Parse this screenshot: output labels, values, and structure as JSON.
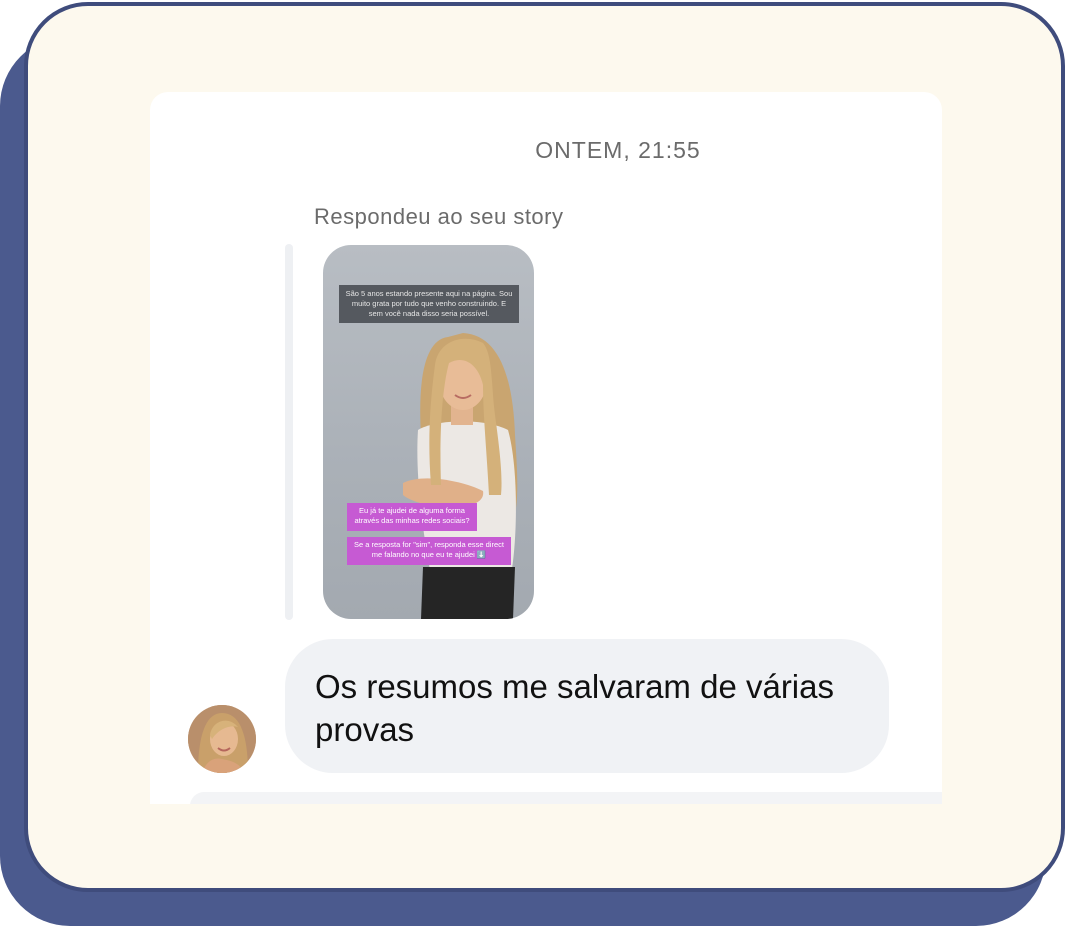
{
  "chat": {
    "timestamp": "ONTEM, 21:55",
    "reply_label": "Respondeu ao seu story",
    "message": "Os resumos me salvaram de várias provas"
  },
  "story": {
    "top_text": "São 5 anos estando presente aqui na página. Sou muito grata por tudo que venho construindo. E sem você nada disso seria possível.",
    "question_text": "Eu já te ajudei de alguma forma através das minhas redes sociais?",
    "instruction_text": "Se a resposta for \"sim\", responda esse direct me falando no que eu te ajudei ⬇️"
  },
  "icons": {
    "avatar": "avatar-icon"
  },
  "colors": {
    "outer_shadow": "#4b5a8e",
    "card_bg": "#fdf9ee",
    "card_border": "#3f4c7c",
    "bubble_bg": "#f0f2f5",
    "story_highlight": "#c65ad3"
  }
}
